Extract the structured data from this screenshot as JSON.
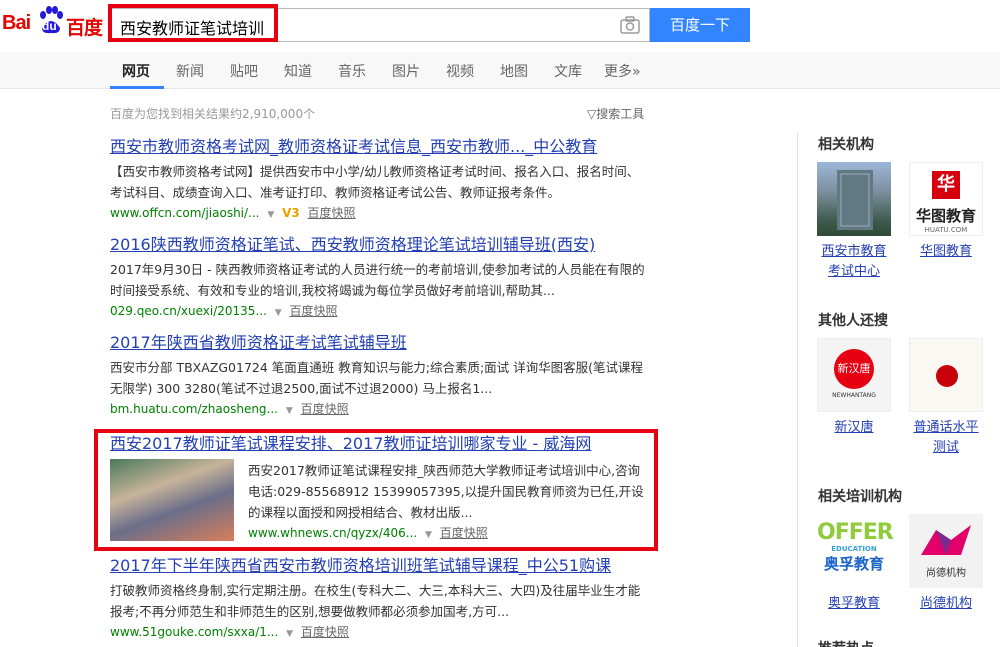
{
  "header": {
    "logo_bai": "Bai",
    "logo_du": "du",
    "logo_cn": "百度",
    "query": "西安教师证笔试培训",
    "search_button": "百度一下"
  },
  "tabs": [
    "网页",
    "新闻",
    "贴吧",
    "知道",
    "音乐",
    "图片",
    "视频",
    "地图",
    "文库",
    "更多»"
  ],
  "stats": "百度为您找到相关结果约2,910,000个",
  "tools": "搜索工具",
  "results": [
    {
      "title": "西安市教师资格考试网_教师资格证考试信息_西安市教师..._中公教育",
      "abstract": "【西安市教师资格考试网】提供西安市中小学/幼儿教师资格证考试时间、报名入口、报名时间、考试科目、成绩查询入口、准考证打印、教师资格证考试公告、教师证报考条件。",
      "url": "www.offcn.com/jiaoshi/...",
      "badge": "V3",
      "snapshot": "百度快照"
    },
    {
      "title": "2016陕西教师资格证笔试、西安教师资格理论笔试培训辅导班(西安)",
      "abstract": "2017年9月30日 - 陕西教师资格证考试的人员进行统一的考前培训,使参加考试的人员能在有限的时间接受系统、有效和专业的培训,我校将竭诚为每位学员做好考前培训,帮助其...",
      "url": "029.qeo.cn/xuexi/20135...",
      "snapshot": "百度快照"
    },
    {
      "title": "2017年陕西省教师资格证考试笔试辅导班",
      "abstract": "西安市分部 TBXAZG01724 笔面直通班 教育知识与能力;综合素质;面试 详询华图客服(笔试课程无限学) 300 3280(笔试不过退2500,面试不过退2000) 马上报名1...",
      "url": "bm.huatu.com/zhaosheng...",
      "snapshot": "百度快照"
    },
    {
      "title": "西安2017教师证笔试课程安排、2017教师证培训哪家专业 - 威海网",
      "abstract": "西安2017教师证笔试课程安排_陕西师范大学教师证考试培训中心,咨询电话:029-85568912 15399057395,以提升国民教育师资为已任,开设的课程以面授和网授相结合、教材出版...",
      "url": "www.whnews.cn/qyzx/406...",
      "snapshot": "百度快照"
    },
    {
      "title": "2017年下半年陕西省西安市教师资格培训班笔试辅导课程_中公51购课",
      "abstract": "打破教师资格终身制,实行定期注册。在校生(专科大二、大三,本科大三、大四)及往届毕业生才能报考;不再分师范生和非师范生的区别,想要做教师都必须参加国考,方可...",
      "url": "www.51gouke.com/sxxa/1...",
      "snapshot": "百度快照"
    }
  ],
  "sidebar": {
    "sections": [
      {
        "heading": "相关机构",
        "items": [
          {
            "label_line1": "西安市教育",
            "label_line2": "考试中心"
          },
          {
            "label_line1": "华图教育",
            "label_line2": "",
            "img_text": "华图教育",
            "img_sub": "HUATU.COM"
          }
        ]
      },
      {
        "heading": "其他人还搜",
        "items": [
          {
            "label_line1": "新汉唐",
            "label_line2": "",
            "img_text": "新汉唐",
            "img_sub": "NEWHANTANG"
          },
          {
            "label_line1": "普通话水平",
            "label_line2": "测试"
          }
        ]
      },
      {
        "heading": "相关培训机构",
        "items": [
          {
            "label_line1": "奥孚教育",
            "label_line2": "",
            "img_text": "奥孚教育",
            "img_sub": "EDUCATION"
          },
          {
            "label_line1": "尚德机构",
            "label_line2": "",
            "img_text": "尚德机构"
          }
        ]
      },
      {
        "heading": "推荐热点"
      }
    ]
  },
  "colors": {
    "link": "#2440b3",
    "highlight": "#c00",
    "url": "#008000",
    "search_button": "#3385ff",
    "annotation_box": "#e60012"
  }
}
